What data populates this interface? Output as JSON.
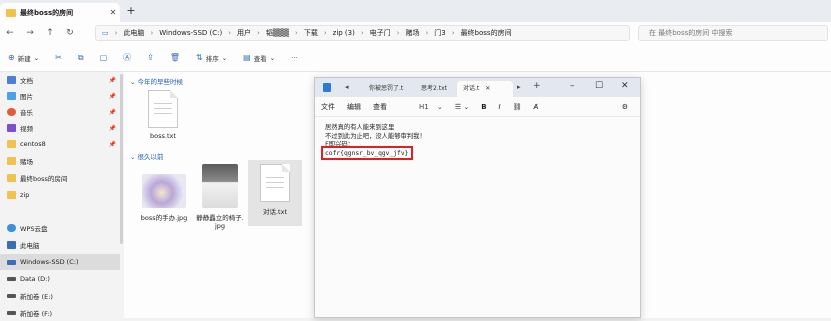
{
  "window": {
    "tab_title": "最终boss的房间",
    "new_tab": "+",
    "close": "✕"
  },
  "address": {
    "crumbs": [
      "此电脑",
      "Windows-SSD (C:)",
      "用户",
      "韬▒▒▒",
      "下载",
      "zip (3)",
      "电子门",
      "赌场",
      "门3",
      "最终boss的房间"
    ],
    "search_placeholder": "在 最终boss的房间 中搜索"
  },
  "toolbar": {
    "new": "新建",
    "sort": "排序",
    "view": "查看",
    "more": "···"
  },
  "sidebar": {
    "items": [
      {
        "label": "文档",
        "color": "#4f7fd0",
        "pin": true
      },
      {
        "label": "图片",
        "color": "#4aa3e8",
        "pin": true
      },
      {
        "label": "音乐",
        "color": "#e25a36",
        "pin": true
      },
      {
        "label": "视频",
        "color": "#7a4fd0",
        "pin": true
      },
      {
        "label": "centos8",
        "color": "#f2c14e",
        "pin": true
      },
      {
        "label": "赌场",
        "color": "#f2c14e",
        "pin": false
      },
      {
        "label": "最终boss的房间",
        "color": "#f2c14e",
        "pin": false
      },
      {
        "label": "zip",
        "color": "#f2c14e",
        "pin": false
      },
      {
        "label": "WPS云盘",
        "color": "#3b8fe0",
        "pin": false
      },
      {
        "label": "此电脑",
        "color": "#3a6fb5",
        "pin": false
      },
      {
        "label": "Windows-SSD (C:)",
        "color": "#3a6fb5",
        "pin": false
      },
      {
        "label": "Data (D:)",
        "color": "#555555",
        "pin": false
      },
      {
        "label": "新加卷 (E:)",
        "color": "#555555",
        "pin": false
      },
      {
        "label": "新加卷 (F:)",
        "color": "#555555",
        "pin": false
      }
    ]
  },
  "groups": {
    "recent": "今年的早些时候",
    "older": "很久以前"
  },
  "files": {
    "boss_txt": "boss.txt",
    "boss_hand": "boss的手办.jpg",
    "chair_line1": "静静矗立的椅子.",
    "chair_line2": "jpg",
    "dialogue": "对话.txt"
  },
  "notepad": {
    "tab1": "你被惩罚了.t",
    "tab2": "思考2.txt",
    "tab3": "对话.t",
    "menu": [
      "文件",
      "编辑",
      "查看"
    ],
    "heading": "H1",
    "bold": "B",
    "italic": "I",
    "lines": [
      "居然真的有人能来到这里",
      "不过到此为止吧，没人能够审判我！",
      "F即兴码：",
      "cofr{qgnsr_bv_qgv_jfv}"
    ]
  }
}
